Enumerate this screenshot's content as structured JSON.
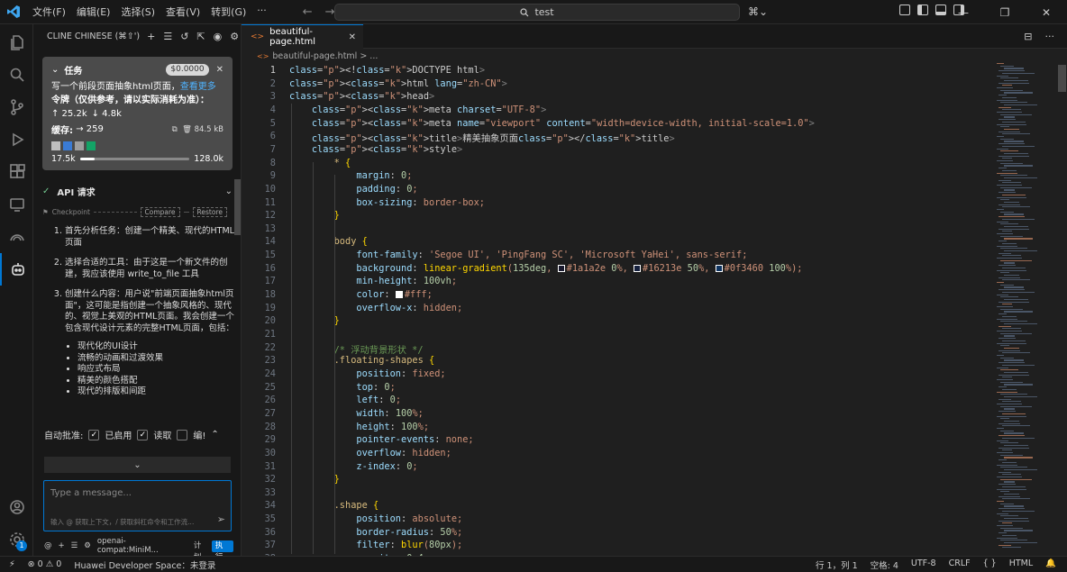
{
  "menu": [
    "文件(F)",
    "编辑(E)",
    "选择(S)",
    "查看(V)",
    "转到(G)"
  ],
  "search": "test",
  "sidebar": {
    "title": "CLINE CHINESE (⌘⇧')",
    "task": {
      "label": "任务",
      "cost": "$0.0000",
      "text": "写一个前段页面抽象html页面，",
      "more": "查看更多",
      "note": "令牌（仅供参考，请以实际消耗为准）：",
      "tokens_up": "↑ 25.2k",
      "tokens_down": "↓ 4.8k",
      "cache_label": "缓存:",
      "cache_value": "→ 259",
      "size": "84.5 kB",
      "ctx_used": "17.5k",
      "ctx_total": "128.0k",
      "ctx_fraction": 0.137,
      "swatch_colors": [
        "#bfbfbf",
        "#3a7bd5",
        "#9e9e9e",
        "#13a366"
      ]
    },
    "api_title": "API 请求",
    "checkpoint": "Checkpoint",
    "compare": "Compare",
    "restore": "Restore",
    "steps": [
      "首先分析任务：创建一个精美、现代的HTML页面",
      "选择合适的工具：由于这是一个新文件的创建，我应该使用 write_to_file 工具",
      "创建什么内容：用户说\"前端页面抽象html页面\"，这可能是指创建一个抽象风格的、现代的、视觉上美观的HTML页面。我会创建一个包含现代设计元素的完整HTML页面，包括："
    ],
    "bullets": [
      "现代化的UI设计",
      "流畅的动画和过渡效果",
      "响应式布局",
      "精美的颜色搭配",
      "现代的排版和间距"
    ],
    "auto_label": "自动批准:",
    "auto_enabled": "已启用",
    "auto_read": "读取",
    "auto_edit": "编!",
    "input_placeholder": "Type a message...",
    "input_hint": "输入 @ 获取上下文，/ 获取斜杠命令和工作流...",
    "model": "openai-compat:MiniM...",
    "plan": "计划",
    "act": "执行"
  },
  "tab": {
    "name": "beautiful-page.html"
  },
  "breadcrumb": "beautiful-page.html > ...",
  "status": {
    "errors": "0",
    "warnings": "0",
    "space": "Huawei Developer Space：未登录",
    "position": "行 1，列 1",
    "spaces": "空格: 4",
    "encoding": "UTF-8",
    "eol": "CRLF",
    "braces": "{ }",
    "lang": "HTML"
  },
  "code": [
    "<!DOCTYPE html>",
    "<html lang=\"zh-CN\">",
    "<head>",
    "    <meta charset=\"UTF-8\">",
    "    <meta name=\"viewport\" content=\"width=device-width, initial-scale=1.0\">",
    "    <title>精美抽象页面</title>",
    "    <style>",
    "        * {",
    "            margin: 0;",
    "            padding: 0;",
    "            box-sizing: border-box;",
    "        }",
    "",
    "        body {",
    "            font-family: 'Segoe UI', 'PingFang SC', 'Microsoft YaHei', sans-serif;",
    "            background: linear-gradient(135deg, #1a1a2e 0%, #16213e 50%, #0f3460 100%);",
    "            min-height: 100vh;",
    "            color: #fff;",
    "            overflow-x: hidden;",
    "        }",
    "",
    "        /* 浮动背景形状 */",
    "        .floating-shapes {",
    "            position: fixed;",
    "            top: 0;",
    "            left: 0;",
    "            width: 100%;",
    "            height: 100%;",
    "            pointer-events: none;",
    "            overflow: hidden;",
    "            z-index: 0;",
    "        }",
    "",
    "        .shape {",
    "            position: absolute;",
    "            border-radius: 50%;",
    "            filter: blur(80px);",
    "            opacity: 0.4;"
  ],
  "swatch_code_colors": [
    "#1a1a2e",
    "#16213e",
    "#0f3460",
    "#fff"
  ]
}
